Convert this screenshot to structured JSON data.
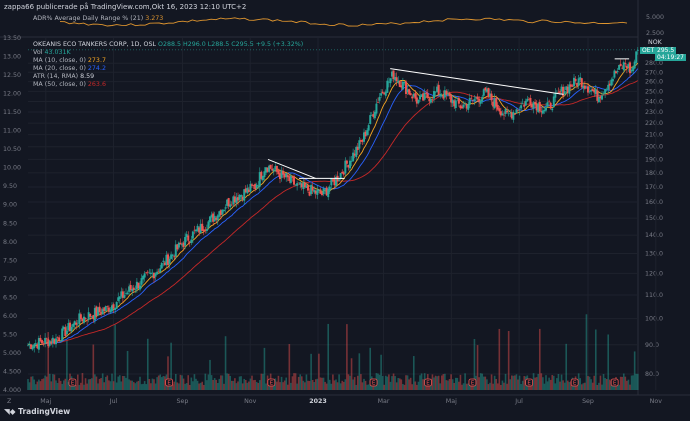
{
  "header": {
    "text": "zappa66 publicerade på TradingView.com,Okt 16, 2023 12:10 UTC+2"
  },
  "brand": {
    "logo_text": "TradingView"
  },
  "adrp_pane": {
    "label": "ADR%",
    "name": "Average Daily Range % (21)",
    "value": "3.273",
    "ticks": [
      "5.000",
      "2.500"
    ],
    "color": "#e0962f"
  },
  "legend": {
    "symbol": "OKEANIS ECO TANKERS CORP, 1D, OSL",
    "ohlc": "O288.5 H296.0 L288.5 C295.5 +9.5 (+3.32%)",
    "vol_label": "Vol",
    "vol_value": "43.031K",
    "ma10_label": "MA (10, close, 0)",
    "ma10_value": "273.7",
    "ma20_label": "MA (20, close, 0)",
    "ma20_value": "274.2",
    "atr_label": "ATR (14, RMA)",
    "atr_value": "8.59",
    "ma50_label": "MA (50, close, 0)",
    "ma50_value": "263.6"
  },
  "price_badge": {
    "symbol": "OET",
    "price": "295.5",
    "countdown": "04:19:27",
    "currency": "NOK"
  },
  "colors": {
    "background": "#131722",
    "up": "#26a69a",
    "down": "#ef5350",
    "ma10": "#f5a623",
    "ma20": "#2962ff",
    "ma50": "#c62828",
    "trendline": "#ffffff"
  },
  "event_icon_letter": "E",
  "chart_data": {
    "type": "candlestick",
    "x_tick_labels": [
      "Maj",
      "Jul",
      "Sep",
      "Nov",
      "2023",
      "Mar",
      "Maj",
      "Jul",
      "Sep",
      "Nov"
    ],
    "left_axis": {
      "ticks": [
        "13.50",
        "13.00",
        "12.50",
        "12.00",
        "11.50",
        "11.00",
        "10.50",
        "10.00",
        "9.50",
        "9.00",
        "8.50",
        "8.00",
        "7.50",
        "7.00",
        "6.50",
        "6.00",
        "5.50",
        "5.000",
        "4.500",
        "4.000"
      ],
      "ylim": [
        4.0,
        13.5
      ]
    },
    "right_axis": {
      "ticks": [
        "280.0",
        "270.0",
        "260.0",
        "250.0",
        "240.0",
        "230.0",
        "220.0",
        "210.0",
        "200.0",
        "190.0",
        "180.0",
        "170.0",
        "160.0",
        "150.0",
        "140.0",
        "130.0",
        "120.0",
        "110.0",
        "100.0",
        "90.0",
        "80.0"
      ],
      "scale": "log",
      "ylim": [
        75,
        310
      ]
    },
    "x_range": [
      "2022-04-15",
      "2023-10-16"
    ],
    "keypoints": [
      {
        "date": "2022-04-15",
        "price": 90
      },
      {
        "date": "2022-05-10",
        "price": 92
      },
      {
        "date": "2022-06-01",
        "price": 100
      },
      {
        "date": "2022-06-25",
        "price": 104
      },
      {
        "date": "2022-07-15",
        "price": 112
      },
      {
        "date": "2022-08-10",
        "price": 122
      },
      {
        "date": "2022-09-05",
        "price": 138
      },
      {
        "date": "2022-09-25",
        "price": 148
      },
      {
        "date": "2022-10-15",
        "price": 162
      },
      {
        "date": "2022-11-05",
        "price": 170
      },
      {
        "date": "2022-11-15",
        "price": 186
      },
      {
        "date": "2022-12-15",
        "price": 170
      },
      {
        "date": "2023-01-05",
        "price": 165
      },
      {
        "date": "2023-01-20",
        "price": 178
      },
      {
        "date": "2023-02-10",
        "price": 205
      },
      {
        "date": "2023-02-25",
        "price": 245
      },
      {
        "date": "2023-03-10",
        "price": 268
      },
      {
        "date": "2023-04-01",
        "price": 240
      },
      {
        "date": "2023-04-20",
        "price": 250
      },
      {
        "date": "2023-05-10",
        "price": 235
      },
      {
        "date": "2023-06-01",
        "price": 248
      },
      {
        "date": "2023-06-20",
        "price": 226
      },
      {
        "date": "2023-07-10",
        "price": 242
      },
      {
        "date": "2023-07-25",
        "price": 232
      },
      {
        "date": "2023-08-10",
        "price": 252
      },
      {
        "date": "2023-08-25",
        "price": 262
      },
      {
        "date": "2023-09-10",
        "price": 245
      },
      {
        "date": "2023-09-25",
        "price": 268
      },
      {
        "date": "2023-10-05",
        "price": 280
      },
      {
        "date": "2023-10-10",
        "price": 270
      },
      {
        "date": "2023-10-16",
        "price": 295.5
      }
    ],
    "trendlines": [
      {
        "x1": "2022-11-17",
        "y1": 190,
        "x2": "2022-12-30",
        "y2": 176
      },
      {
        "x1": "2022-12-15",
        "y1": 176,
        "x2": "2023-01-25",
        "y2": 176
      },
      {
        "x1": "2023-03-07",
        "y1": 274,
        "x2": "2023-08-10",
        "y2": 247
      },
      {
        "x1": "2023-09-25",
        "y1": 285,
        "x2": "2023-10-08",
        "y2": 285
      }
    ]
  }
}
